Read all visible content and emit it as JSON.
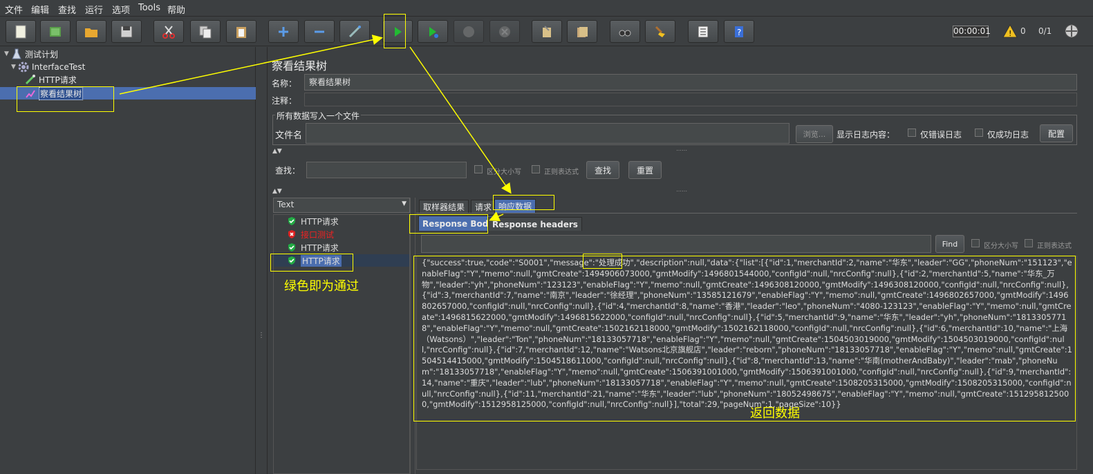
{
  "menu": [
    "文件",
    "编辑",
    "查找",
    "运行",
    "选项",
    "Tools",
    "帮助"
  ],
  "toolbar": {
    "timer": "00:00:01",
    "warnings": "0",
    "threads": "0/1"
  },
  "tree": {
    "plan": "测试计划",
    "thread_group": "InterfaceTest",
    "sampler": "HTTP请求",
    "listener": "察看结果树"
  },
  "panel": {
    "title": "察看结果树",
    "name_label": "名称：",
    "name_value": "察看结果树",
    "comment_label": "注释：",
    "file_section": "所有数据写入一个文件",
    "file_label": "文件名",
    "browse_button": "浏览...",
    "log_label": "显示日志内容：",
    "errors_only": "仅错误日志",
    "success_only": "仅成功日志",
    "configure_button": "配置",
    "search_label": "查找：",
    "case_sensitive": "区分大小写",
    "regex": "正则表达式",
    "search_button": "查找",
    "reset_button": "重置"
  },
  "renderer": {
    "selected": "Text"
  },
  "results": [
    {
      "label": "HTTP请求",
      "status": "pass"
    },
    {
      "label": "接口测试",
      "status": "fail"
    },
    {
      "label": "HTTP请求",
      "status": "pass"
    },
    {
      "label": "HTTP请求",
      "status": "pass",
      "selected": true
    }
  ],
  "tabs": {
    "sampler_result": "取样器结果",
    "request": "请求",
    "response_data": "响应数据",
    "response_body": "Response Body",
    "response_headers": "Response headers"
  },
  "response_find": {
    "button": "Find",
    "case_sensitive": "区分大小写",
    "regex": "正则表达式"
  },
  "response_body": "{\"success\":true,\"code\":\"S0001\",\"message\":\"处理成功\",\"description\":null,\"data\":{\"list\":[{\"id\":1,\"merchantId\":2,\"name\":\"华东\",\"leader\":\"GG\",\"phoneNum\":\"151123\",\"enableFlag\":\"Y\",\"memo\":null,\"gmtCreate\":1494906073000,\"gmtModify\":1496801544000,\"configId\":null,\"nrcConfig\":null},{\"id\":2,\"merchantId\":5,\"name\":\"华东_万物\",\"leader\":\"yh\",\"phoneNum\":\"123123\",\"enableFlag\":\"Y\",\"memo\":null,\"gmtCreate\":1496308120000,\"gmtModify\":1496308120000,\"configId\":null,\"nrcConfig\":null},{\"id\":3,\"merchantId\":7,\"name\":\"南京\",\"leader\":\"徐经理\",\"phoneNum\":\"13585121679\",\"enableFlag\":\"Y\",\"memo\":null,\"gmtCreate\":1496802657000,\"gmtModify\":1496802657000,\"configId\":null,\"nrcConfig\":null},{\"id\":4,\"merchantId\":8,\"name\":\"香港\",\"leader\":\"leo\",\"phoneNum\":\"4080-123123\",\"enableFlag\":\"Y\",\"memo\":null,\"gmtCreate\":1496815622000,\"gmtModify\":1496815622000,\"configId\":null,\"nrcConfig\":null},{\"id\":5,\"merchantId\":9,\"name\":\"华东\",\"leader\":\"yh\",\"phoneNum\":\"18133057718\",\"enableFlag\":\"Y\",\"memo\":null,\"gmtCreate\":1502162118000,\"gmtModify\":1502162118000,\"configId\":null,\"nrcConfig\":null},{\"id\":6,\"merchantId\":10,\"name\":\"上海（Watsons）\",\"leader\":\"Ton\",\"phoneNum\":\"18133057718\",\"enableFlag\":\"Y\",\"memo\":null,\"gmtCreate\":1504503019000,\"gmtModify\":1504503019000,\"configId\":null,\"nrcConfig\":null},{\"id\":7,\"merchantId\":12,\"name\":\"Watsons北京旗舰店\",\"leader\":\"reborn\",\"phoneNum\":\"18133057718\",\"enableFlag\":\"Y\",\"memo\":null,\"gmtCreate\":1504514415000,\"gmtModify\":1504518611000,\"configId\":null,\"nrcConfig\":null},{\"id\":8,\"merchantId\":13,\"name\":\"华南(motherAndBaby)\",\"leader\":\"mab\",\"phoneNum\":\"18133057718\",\"enableFlag\":\"Y\",\"memo\":null,\"gmtCreate\":1506391001000,\"gmtModify\":1506391001000,\"configId\":null,\"nrcConfig\":null},{\"id\":9,\"merchantId\":14,\"name\":\"重庆\",\"leader\":\"lub\",\"phoneNum\":\"18133057718\",\"enableFlag\":\"Y\",\"memo\":null,\"gmtCreate\":1508205315000,\"gmtModify\":1508205315000,\"configId\":null,\"nrcConfig\":null},{\"id\":11,\"merchantId\":21,\"name\":\"华东\",\"leader\":\"lub\",\"phoneNum\":\"18052498675\",\"enableFlag\":\"Y\",\"memo\":null,\"gmtCreate\":1512958125000,\"gmtModify\":1512958125000,\"configId\":null,\"nrcConfig\":null}],\"total\":29,\"pageNum\":1,\"pageSize\":10}}",
  "annotations": {
    "green_pass": "绿色即为通过",
    "return_data": "返回数据"
  },
  "colors": {
    "background": "#3c3f41",
    "selection": "#4b6eaf",
    "annotation": "#ffff00",
    "pass": "#22aa44",
    "fail": "#dd2222"
  }
}
